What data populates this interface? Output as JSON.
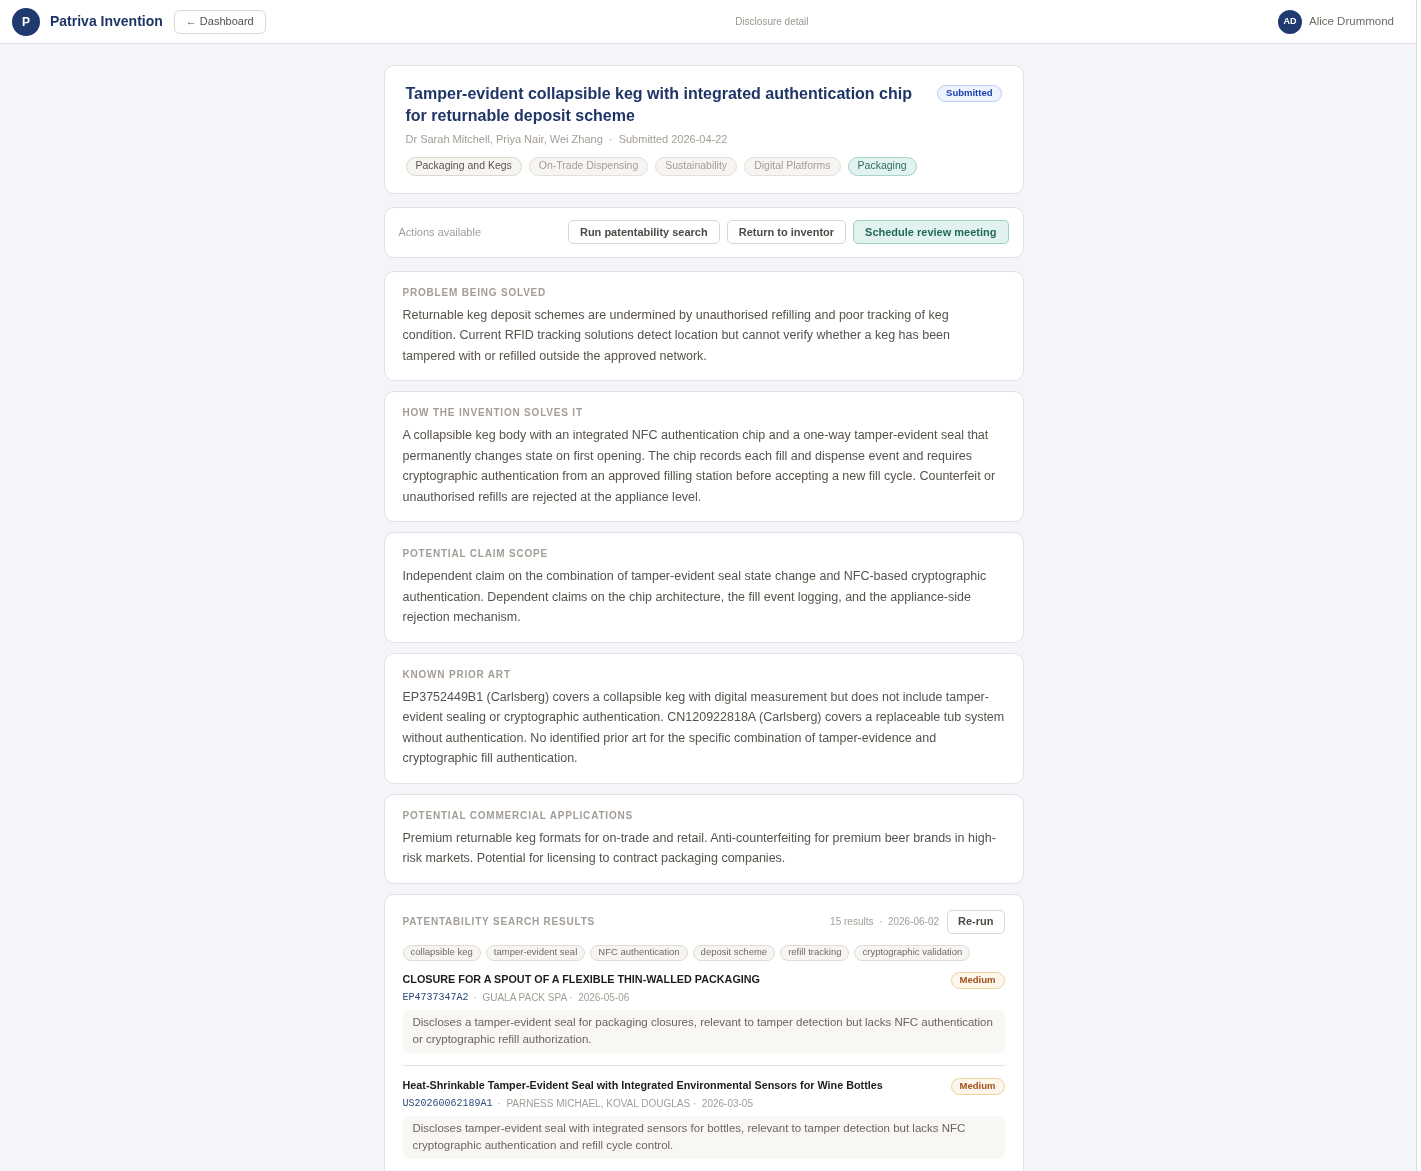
{
  "header": {
    "logo_letter": "P",
    "app_name": "Patriva Invention",
    "back_button": "← Dashboard",
    "page_title": "Disclosure detail",
    "user": {
      "initials": "AD",
      "name": "Alice Drummond"
    }
  },
  "disclosure": {
    "title": "Tamper-evident collapsible keg with integrated authentication chip for returnable deposit scheme",
    "status": "Submitted",
    "meta": "Dr Sarah Mitchell, Priya Nair, Wei Zhang  ·  Submitted 2026-04-22",
    "tags": [
      {
        "label": "Packaging and Kegs",
        "kind": "primary"
      },
      {
        "label": "On-Trade Dispensing",
        "kind": "secondary"
      },
      {
        "label": "Sustainability",
        "kind": "secondary"
      },
      {
        "label": "Digital Platforms",
        "kind": "secondary"
      },
      {
        "label": "Packaging",
        "kind": "accent"
      }
    ]
  },
  "actions": {
    "label": "Actions available",
    "buttons": [
      {
        "label": "Run patentability search",
        "kind": "default"
      },
      {
        "label": "Return to inventor",
        "kind": "default"
      },
      {
        "label": "Schedule review meeting",
        "kind": "primary"
      }
    ]
  },
  "sections": [
    {
      "heading": "PROBLEM BEING SOLVED",
      "body": "Returnable keg deposit schemes are undermined by unauthorised refilling and poor tracking of keg condition. Current RFID tracking solutions detect location but cannot verify whether a keg has been tampered with or refilled outside the approved network."
    },
    {
      "heading": "HOW THE INVENTION SOLVES IT",
      "body": "A collapsible keg body with an integrated NFC authentication chip and a one-way tamper-evident seal that permanently changes state on first opening. The chip records each fill and dispense event and requires cryptographic authentication from an approved filling station before accepting a new fill cycle. Counterfeit or unauthorised refills are rejected at the appliance level."
    },
    {
      "heading": "POTENTIAL CLAIM SCOPE",
      "body": "Independent claim on the combination of tamper-evident seal state change and NFC-based cryptographic authentication. Dependent claims on the chip architecture, the fill event logging, and the appliance-side rejection mechanism."
    },
    {
      "heading": "KNOWN PRIOR ART",
      "body": "EP3752449B1 (Carlsberg) covers a collapsible keg with digital measurement but does not include tamper-evident sealing or cryptographic authentication. CN120922818A (Carlsberg) covers a replaceable tub system without authentication. No identified prior art for the specific combination of tamper-evidence and cryptographic fill authentication."
    },
    {
      "heading": "POTENTIAL COMMERCIAL APPLICATIONS",
      "body": "Premium returnable keg formats for on-trade and retail. Anti-counterfeiting for premium beer brands in high-risk markets. Potential for licensing to contract packaging companies."
    }
  ],
  "search_results": {
    "heading": "PATENTABILITY SEARCH RESULTS",
    "summary": "15 results  ·  2026-06-02",
    "rerun_button": "Re-run",
    "keywords": [
      "collapsible keg",
      "tamper-evident seal",
      "NFC authentication",
      "deposit scheme",
      "refill tracking",
      "cryptographic validation"
    ],
    "results": [
      {
        "title": "CLOSURE FOR A SPOUT OF A FLEXIBLE THIN-WALLED PACKAGING",
        "number": "EP4737347A2",
        "meta": "·  GUALA PACK SPA ·  2026-05-06",
        "relevance": {
          "label": "Medium",
          "kind": "medium"
        },
        "summary": "Discloses a tamper-evident seal for packaging closures, relevant to tamper detection but lacks NFC authentication or cryptographic refill authorization."
      },
      {
        "title": "Heat-Shrinkable Tamper-Evident Seal with Integrated Environmental Sensors for Wine Bottles",
        "number": "US20260062189A1",
        "meta": "·  PARNESS MICHAEL, KOVAL DOUGLAS ·  2026-03-05",
        "relevance": {
          "label": "Medium",
          "kind": "medium"
        },
        "summary": "Discloses tamper-evident seal with integrated sensors for bottles, relevant to tamper detection but lacks NFC cryptographic authentication and refill cycle control."
      }
    ]
  }
}
